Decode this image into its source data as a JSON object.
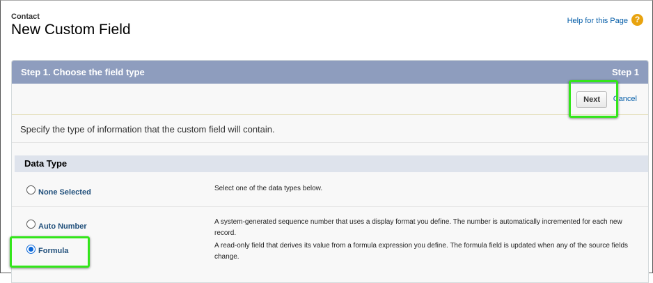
{
  "header": {
    "object_label": "Contact",
    "title": "New Custom Field",
    "help_link": "Help for this Page",
    "help_icon": "?"
  },
  "panel": {
    "step_title": "Step 1. Choose the field type",
    "step_indicator": "Step 1",
    "next_label": "Next",
    "cancel_label": "Cancel",
    "instructions": "Specify the type of information that the custom field will contain."
  },
  "data_type": {
    "section_title": "Data Type",
    "options": [
      {
        "label": "None Selected",
        "description": "Select one of the data types below.",
        "selected": false
      },
      {
        "label": "Auto Number",
        "description": "A system-generated sequence number that uses a display format you define. The number is automatically incremented for each new record.",
        "selected": false
      },
      {
        "label": "Formula",
        "description": "A read-only field that derives its value from a formula expression you define. The formula field is updated when any of the source fields change.",
        "selected": true
      }
    ]
  },
  "colors": {
    "header_bar": "#8e9dbe",
    "section_bar": "#dee3ec",
    "link": "#015ba7",
    "highlight": "#33e61a"
  }
}
